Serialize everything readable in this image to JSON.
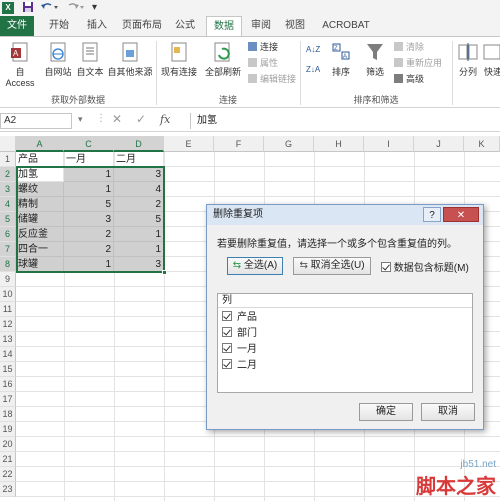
{
  "qat": {
    "app_icon": "X"
  },
  "tabs": [
    "文件",
    "开始",
    "插入",
    "页面布局",
    "公式",
    "数据",
    "审阅",
    "视图",
    "ACROBAT"
  ],
  "ribbon": {
    "external_group": "获取外部数据",
    "btn_access": "自 Access",
    "btn_web": "自网站",
    "btn_text": "自文本",
    "btn_other": "自其他来源",
    "btn_existing": "现有连接",
    "btn_refresh": "全部刷新",
    "conn_group": "连接",
    "conn": "连接",
    "props": "属性",
    "edit_links": "编辑链接",
    "sort_group": "排序和筛选",
    "sort": "排序",
    "filter": "筛选",
    "clear": "清除",
    "reapply": "重新应用",
    "advanced": "高级",
    "split": "分列",
    "flash": "快速"
  },
  "formula": {
    "name_box": "A2",
    "fx": "fx",
    "value": "加氢"
  },
  "columns": [
    "A",
    "C",
    "D",
    "E",
    "F",
    "G",
    "H",
    "I",
    "J",
    "K"
  ],
  "rows": [
    "1",
    "2",
    "3",
    "4",
    "5",
    "6",
    "7",
    "8",
    "9",
    "10",
    "11",
    "12",
    "13",
    "14",
    "15",
    "16",
    "17",
    "18",
    "19",
    "20",
    "21",
    "22",
    "23"
  ],
  "headers_row": [
    "产品",
    "一月",
    "二月"
  ],
  "data": [
    [
      "加氢",
      "1",
      "3"
    ],
    [
      "螺纹",
      "1",
      "4"
    ],
    [
      "精制",
      "5",
      "2"
    ],
    [
      "储罐",
      "3",
      "5"
    ],
    [
      "反应釜",
      "2",
      "1"
    ],
    [
      "四合一",
      "2",
      "1"
    ],
    [
      "球罐",
      "1",
      "3"
    ]
  ],
  "dialog": {
    "title": "删除重复项",
    "description": "若要删除重复值，请选择一个或多个包含重复值的列。",
    "select_all": "全选(A)",
    "unselect_all": "取消全选(U)",
    "has_headers": "数据包含标题(M)",
    "list_header": "列",
    "items": [
      "产品",
      "部门",
      "一月",
      "二月"
    ],
    "ok": "确定",
    "cancel": "取消"
  },
  "watermark": {
    "line1": "jb51.net",
    "line2": "脚本之家"
  }
}
